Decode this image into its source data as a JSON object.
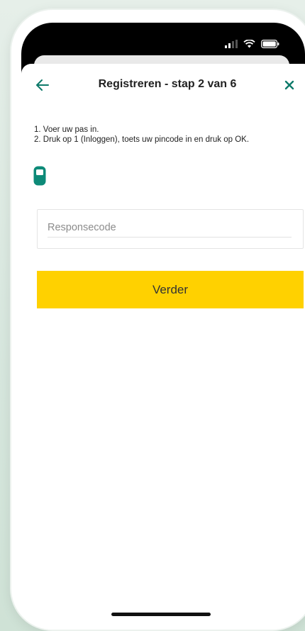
{
  "header": {
    "title": "Registreren - stap 2 van 6",
    "back_icon": "arrow-left-icon",
    "close_icon": "close-icon"
  },
  "instructions": {
    "line1": "1. Voer uw pas in.",
    "line2": "2. Druk op 1 (Inloggen), toets uw pincode in en druk op OK."
  },
  "device_icon": "card-reader-icon",
  "response_field": {
    "placeholder": "Responsecode",
    "value": ""
  },
  "primary_button": {
    "label": "Verder"
  },
  "colors": {
    "accent": "#0d7a6a",
    "button": "#ffd100",
    "text": "#222222"
  }
}
